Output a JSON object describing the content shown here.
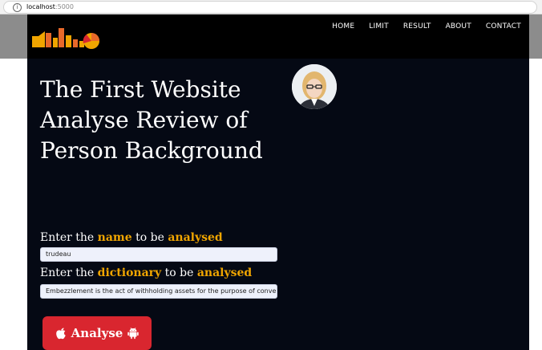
{
  "browser": {
    "url_host": "localhost",
    "url_port": ":5000"
  },
  "nav": {
    "items": [
      "HOME",
      "LIMIT",
      "RESULT",
      "ABOUT",
      "CONTACT"
    ]
  },
  "hero": {
    "title": "The First Website Analyse Review of Person Background"
  },
  "form": {
    "name_label": {
      "prefix": "Enter the ",
      "keyword": "name",
      "middle": " to be ",
      "action": "analysed"
    },
    "name_value": "trudeau",
    "dictionary_label": {
      "prefix": "Enter the ",
      "keyword": "dictionary",
      "middle": " to be ",
      "action": "analysed"
    },
    "dictionary_value": "Embezzlement is the act of withholding assets for the purpose of conversion (tl",
    "submit_label": "Analyse"
  },
  "colors": {
    "accent": "#f0a500",
    "button": "#d9262f",
    "page_bg": "#050914"
  }
}
